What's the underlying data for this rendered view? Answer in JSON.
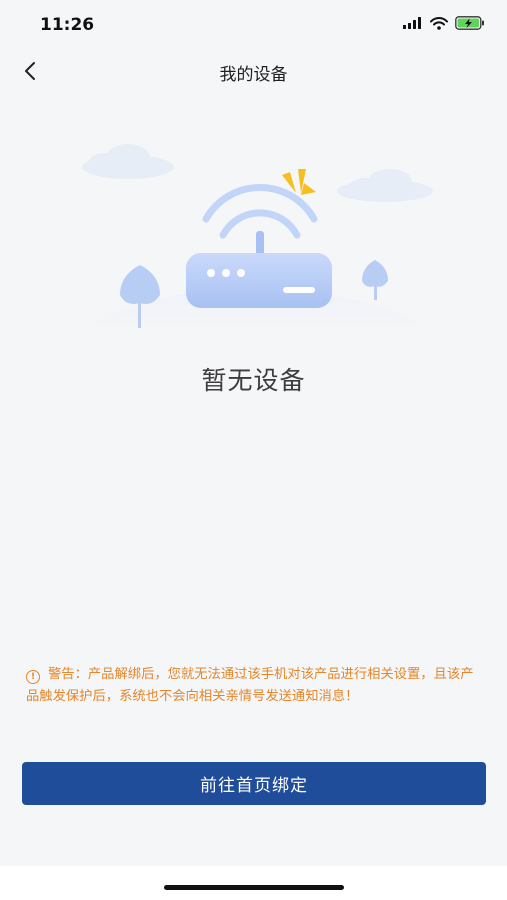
{
  "status_bar": {
    "time": "11:26"
  },
  "nav": {
    "title": "我的设备",
    "back_icon": "chevron-left-icon"
  },
  "empty_state": {
    "text": "暂无设备",
    "illustration_icon": "wifi-router-icon"
  },
  "warning": {
    "icon": "alert-circle-icon",
    "text": "警告：产品解绑后，您就无法通过该手机对该产品进行相关设置，且该产品触发保护后，系统也不会向相关亲情号发送通知消息！"
  },
  "action": {
    "button_label": "前往首页绑定"
  },
  "colors": {
    "primary": "#1f4d9a",
    "warning": "#e4862b",
    "background": "#f5f6f8"
  }
}
